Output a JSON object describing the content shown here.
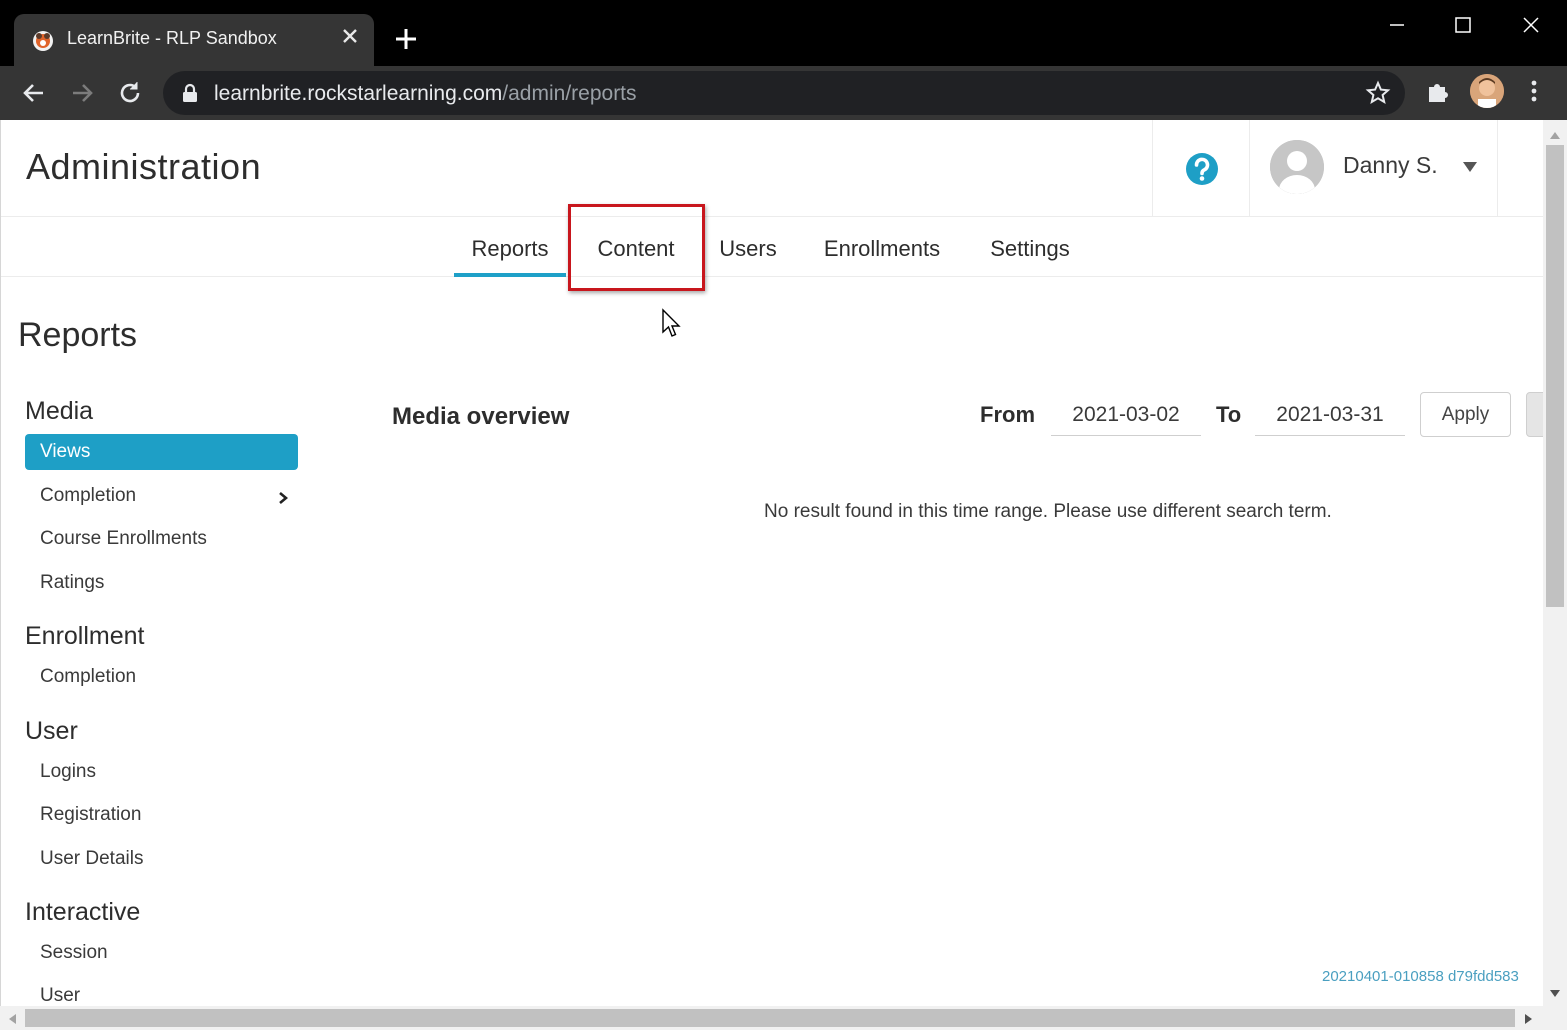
{
  "browser": {
    "tab_title": "LearnBrite - RLP Sandbox",
    "url_host": "learnbrite.rockstarlearning.com",
    "url_path": "/admin/reports"
  },
  "header": {
    "title": "Administration",
    "user_name": "Danny S."
  },
  "nav_tabs": [
    {
      "label": "Reports",
      "active": true
    },
    {
      "label": "Content",
      "active": false
    },
    {
      "label": "Users",
      "active": false
    },
    {
      "label": "Enrollments",
      "active": false
    },
    {
      "label": "Settings",
      "active": false
    }
  ],
  "sidebar": {
    "title": "Reports",
    "groups": [
      {
        "label": "Media",
        "items": [
          {
            "label": "Views",
            "active": true
          },
          {
            "label": "Completion",
            "has_submenu": true
          },
          {
            "label": "Course Enrollments"
          },
          {
            "label": "Ratings"
          }
        ]
      },
      {
        "label": "Enrollment",
        "items": [
          {
            "label": "Completion"
          }
        ]
      },
      {
        "label": "User",
        "items": [
          {
            "label": "Logins"
          },
          {
            "label": "Registration"
          },
          {
            "label": "User Details"
          }
        ]
      },
      {
        "label": "Interactive",
        "items": [
          {
            "label": "Session"
          },
          {
            "label": "User"
          }
        ]
      }
    ]
  },
  "main": {
    "title": "Media overview",
    "from_label": "From",
    "from_value": "2021-03-02",
    "to_label": "To",
    "to_value": "2021-03-31",
    "apply_label": "Apply",
    "empty_message": "No result found in this time range. Please use different search term.",
    "build_id": "20210401-010858 d79fdd583"
  },
  "colors": {
    "accent": "#1e9fc6",
    "highlight": "#c8161d",
    "help_icon": "#1e9fc6"
  },
  "icons": [
    "app-favicon-icon",
    "close-icon",
    "plus-icon",
    "minimize-icon",
    "maximize-icon",
    "back-arrow-icon",
    "forward-arrow-icon",
    "reload-icon",
    "lock-icon",
    "star-icon",
    "puzzle-icon",
    "kebab-menu-icon",
    "help-icon",
    "caret-down-icon",
    "chevron-right-icon",
    "mouse-cursor-icon"
  ]
}
